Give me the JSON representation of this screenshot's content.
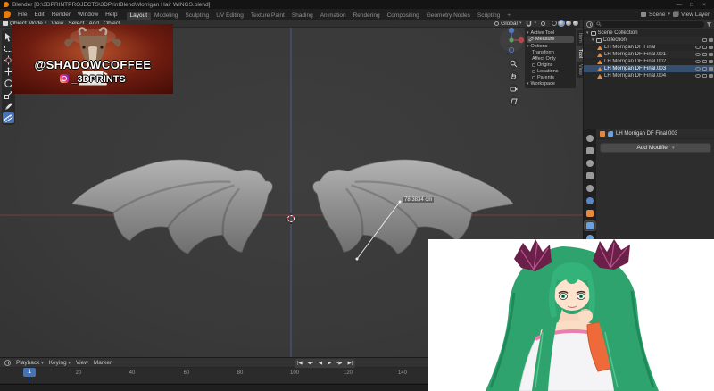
{
  "window": {
    "title": "Blender  [D:\\3DPRINTPROJECTS\\3DPrintBlend\\Morrigan Hair WINGS.blend]",
    "controls": [
      "—",
      "□",
      "×"
    ]
  },
  "topbar": {
    "menus": [
      "File",
      "Edit",
      "Render",
      "Window",
      "Help"
    ],
    "workspaces": [
      "Layout",
      "Modeling",
      "Sculpting",
      "UV Editing",
      "Texture Paint",
      "Shading",
      "Animation",
      "Rendering",
      "Compositing",
      "Geometry Nodes",
      "Scripting"
    ],
    "active_workspace": "Layout",
    "add_workspace": "+",
    "scene_label": "Scene",
    "view_layer_label": "View Layer"
  },
  "viewport": {
    "mode": "Object Mode",
    "menus": [
      "View",
      "Select",
      "Add",
      "Object"
    ],
    "orientation": "Global",
    "measure_label": "78.3834 cm",
    "caret": "▾"
  },
  "tool_sidebar": {
    "tabs": [
      "Item",
      "Tool",
      "View"
    ],
    "active_tab": "Tool",
    "active_tool_header": "Active Tool",
    "tool_name": "Measure",
    "options_header": "Options",
    "transform_label": "Transform",
    "affect_only_label": "Affect Only",
    "affect_options": [
      "Origins",
      "Locations",
      "Parents"
    ],
    "workspace_header": "Workspace"
  },
  "logo_overlay": {
    "line1": "@SHADOWCOFFEE",
    "line2": "_3DPRINTS"
  },
  "outliner": {
    "rows": [
      {
        "label": "Scene Collection",
        "type": "collection"
      },
      {
        "label": "Collection",
        "type": "collection"
      },
      {
        "label": "LH Morrigan DF Final",
        "type": "mesh"
      },
      {
        "label": "LH Morrigan DF Final.001",
        "type": "mesh"
      },
      {
        "label": "LH Morrigan DF Final.002",
        "type": "mesh"
      },
      {
        "label": "LH Morrigan DF Final.003",
        "type": "mesh",
        "active": true
      },
      {
        "label": "LH Morrigan DF Final.004",
        "type": "mesh"
      }
    ]
  },
  "properties": {
    "object_name": "LH Morrigan DF Final.003",
    "add_modifier_label": "Add Modifier"
  },
  "timeline": {
    "menus": [
      "Playback",
      "Keying",
      "View",
      "Marker"
    ],
    "transport": [
      "|◀",
      "◀•",
      "◀",
      "▶",
      "•▶",
      "▶|"
    ],
    "frame_labels": [
      "20",
      "40",
      "60",
      "80",
      "100",
      "120",
      "140"
    ],
    "current_frame": "1"
  },
  "colors": {
    "accent_blue": "#4772b3",
    "object_orange": "#e8883a",
    "axis_x_red": "#aa4646",
    "axis_z_blue": "#5573b9"
  }
}
